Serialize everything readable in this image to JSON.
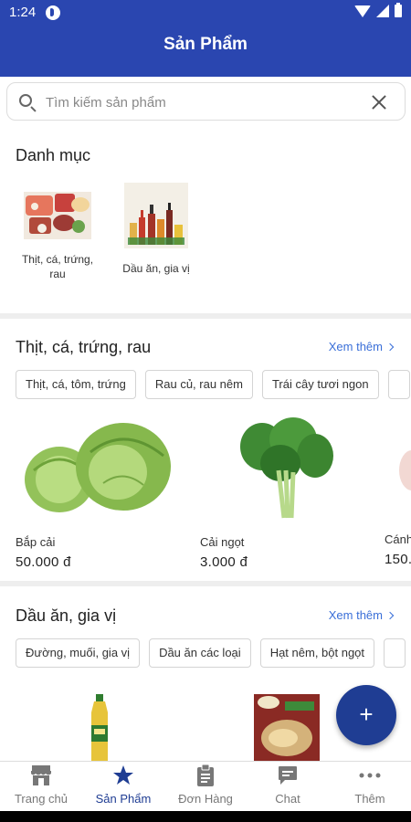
{
  "status_bar": {
    "time": "1:24"
  },
  "header": {
    "title": "Sản Phẩm"
  },
  "search": {
    "placeholder": "Tìm kiếm sản phẩm",
    "value": ""
  },
  "categories": {
    "title": "Danh mục",
    "items": [
      {
        "label": "Thịt, cá, trứng, rau"
      },
      {
        "label": "Dầu ăn, gia vị"
      }
    ]
  },
  "sections": [
    {
      "title": "Thịt, cá, trứng, rau",
      "more": "Xem thêm",
      "chips": [
        "Thịt, cá, tôm, trứng",
        "Rau củ, rau nêm",
        "Trái cây tươi ngon"
      ],
      "products": [
        {
          "name": "Bắp cải",
          "price": "50.000 đ"
        },
        {
          "name": "Cải ngọt",
          "price": "3.000 đ"
        },
        {
          "name": "Cánh",
          "price": "150."
        }
      ]
    },
    {
      "title": "Dầu ăn, gia vị",
      "more": "Xem thêm",
      "chips": [
        "Đường, muối, gia vị",
        "Dầu ăn các loại",
        "Hạt nêm, bột ngọt"
      ]
    }
  ],
  "fab": {
    "label": "+"
  },
  "bottom_nav": {
    "items": [
      {
        "label": "Trang chủ",
        "icon": "store-icon"
      },
      {
        "label": "Sản Phẩm",
        "icon": "star-icon",
        "active": true
      },
      {
        "label": "Đơn Hàng",
        "icon": "clipboard-icon"
      },
      {
        "label": "Chat",
        "icon": "chat-icon"
      },
      {
        "label": "Thêm",
        "icon": "more-icon"
      }
    ]
  },
  "colors": {
    "primary": "#2a46b0",
    "fab": "#1f3d93",
    "link": "#3a6fd8"
  }
}
